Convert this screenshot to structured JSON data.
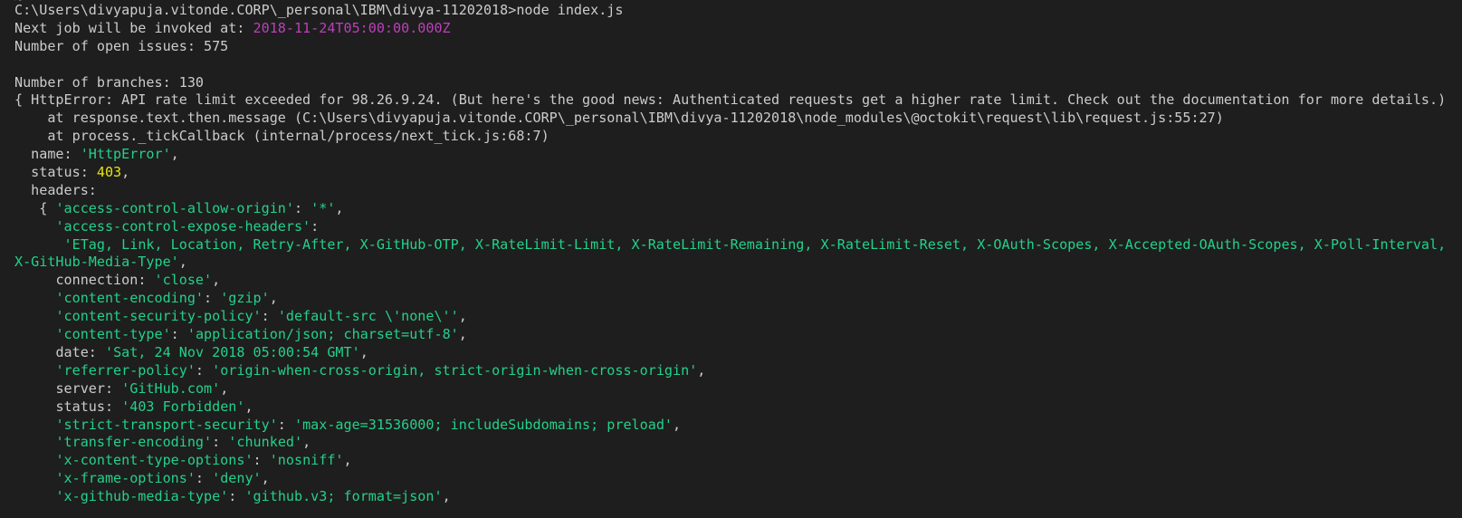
{
  "terminal": {
    "partial_top": "~",
    "command_line": "C:\\Users\\divyapuja.vitonde.CORP\\_personal\\IBM\\divya-11202018>node index.js",
    "next_job_prefix": "Next job will be invoked at: ",
    "next_job_time": "2018-11-24T05:00:00.000Z",
    "open_issues": "Number of open issues: 575",
    "branches": "Number of branches: 130",
    "error_line": "{ HttpError: API rate limit exceeded for 98.26.9.24. (But here's the good news: Authenticated requests get a higher rate limit. Check out the documentation for more details.)",
    "stack_1": "    at response.text.then.message (C:\\Users\\divyapuja.vitonde.CORP\\_personal\\IBM\\divya-11202018\\node_modules\\@octokit\\request\\lib\\request.js:55:27)",
    "stack_2": "    at process._tickCallback (internal/process/next_tick.js:68:7)",
    "name_key": "  name: ",
    "name_val": "'HttpError'",
    "status_key": "  status: ",
    "status_val": "403",
    "headers_key": "  headers:",
    "headers_open": "   { ",
    "acao_key": "'access-control-allow-origin'",
    "acao_val": "'*'",
    "aceh_key": "'access-control-expose-headers'",
    "aceh_val": "'ETag, Link, Location, Retry-After, X-GitHub-OTP, X-RateLimit-Limit, X-RateLimit-Remaining, X-RateLimit-Reset, X-OAuth-Scopes, X-Accepted-OAuth-Scopes, X-Poll-Interval, X-GitHub-Media-Type'",
    "rows": [
      {
        "key": "connection",
        "quoted": false,
        "val": "'close'"
      },
      {
        "key": "'content-encoding'",
        "quoted": true,
        "val": "'gzip'"
      },
      {
        "key": "'content-security-policy'",
        "quoted": true,
        "val": "'default-src \\'none\\''"
      },
      {
        "key": "'content-type'",
        "quoted": true,
        "val": "'application/json; charset=utf-8'"
      },
      {
        "key": "date",
        "quoted": false,
        "val": "'Sat, 24 Nov 2018 05:00:54 GMT'"
      },
      {
        "key": "'referrer-policy'",
        "quoted": true,
        "val": "'origin-when-cross-origin, strict-origin-when-cross-origin'"
      },
      {
        "key": "server",
        "quoted": false,
        "val": "'GitHub.com'"
      },
      {
        "key": "status",
        "quoted": false,
        "val": "'403 Forbidden'"
      },
      {
        "key": "'strict-transport-security'",
        "quoted": true,
        "val": "'max-age=31536000; includeSubdomains; preload'"
      },
      {
        "key": "'transfer-encoding'",
        "quoted": true,
        "val": "'chunked'"
      },
      {
        "key": "'x-content-type-options'",
        "quoted": true,
        "val": "'nosniff'"
      },
      {
        "key": "'x-frame-options'",
        "quoted": true,
        "val": "'deny'"
      },
      {
        "key": "'x-github-media-type'",
        "quoted": true,
        "val": "'github.v3; format=json'"
      }
    ]
  },
  "colors": {
    "background": "#1e1e1e",
    "foreground": "#cccccc",
    "string": "#23d18b",
    "number": "#e5e510",
    "timestamp": "#bc3fbc"
  }
}
